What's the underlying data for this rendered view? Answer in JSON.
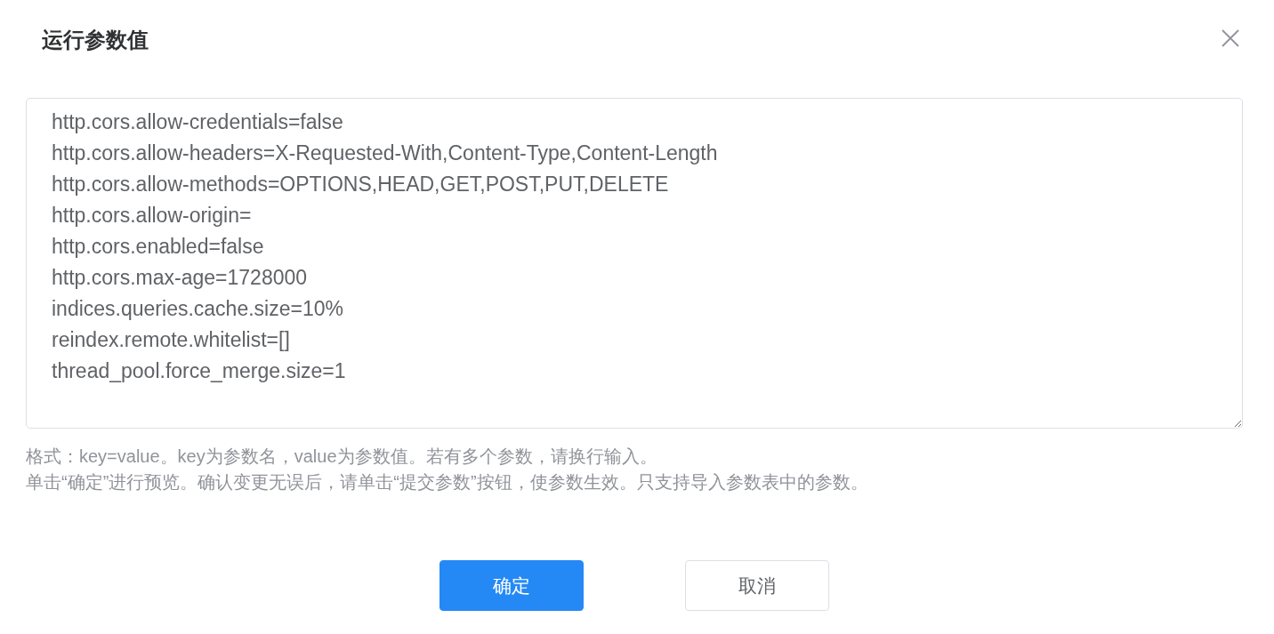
{
  "dialog": {
    "title": "运行参数值"
  },
  "parameters_field": {
    "value_lines": [
      "http.cors.allow-credentials=false",
      "http.cors.allow-headers=X-Requested-With,Content-Type,Content-Length",
      "http.cors.allow-methods=OPTIONS,HEAD,GET,POST,PUT,DELETE",
      "http.cors.allow-origin=",
      "http.cors.enabled=false",
      "http.cors.max-age=1728000",
      "indices.queries.cache.size=10%",
      "reindex.remote.whitelist=[]",
      "thread_pool.force_merge.size=1"
    ]
  },
  "help_lines": [
    "格式：key=value。key为参数名，value为参数值。若有多个参数，请换行输入。",
    "单击“确定”进行预览。确认变更无误后，请单击“提交参数”按钮，使参数生效。只支持导入参数表中的参数。"
  ],
  "buttons": [
    {
      "label": "确定",
      "kind": "primary"
    },
    {
      "label": "取消",
      "kind": "default"
    }
  ]
}
